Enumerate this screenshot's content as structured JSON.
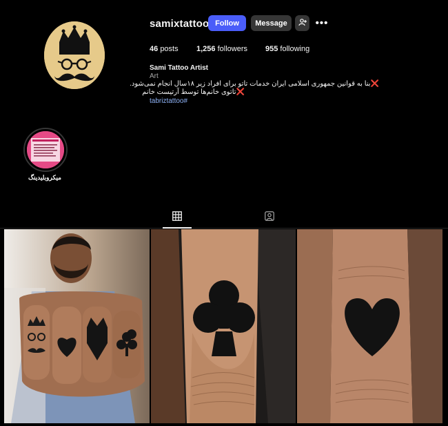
{
  "profile": {
    "username": "samixtattoo",
    "full_name": "Sami Tattoo Artist",
    "category": "Art",
    "bio_line_1": "بنا به قوانین جمهوری اسلامی ایران خدمات تاتو برای افراد زیر ۱۸سال انجام نمی‌شود.",
    "bio_line_2": "تاتوی خانم‌ها توسط آرتیست خانم",
    "bio_mark": "❌",
    "hashtag": "tabriztattoo#"
  },
  "actions": {
    "follow_label": "Follow",
    "message_label": "Message",
    "more_label": "•••",
    "suggest_icon": "person-plus-icon"
  },
  "stats": {
    "posts_count": "46",
    "posts_label": "posts",
    "followers_count": "1,256",
    "followers_label": "followers",
    "following_count": "955",
    "following_label": "following"
  },
  "highlights": [
    {
      "label": "میکروبلیدینگ"
    }
  ],
  "tabs": [
    {
      "icon": "grid-icon",
      "active": true
    },
    {
      "icon": "tagged-icon",
      "active": false
    }
  ],
  "posts": [
    {
      "subject": "knuckle tattoos: crown, heart, wolf, club"
    },
    {
      "subject": "club symbol finger tattoo"
    },
    {
      "subject": "heart symbol finger tattoo"
    }
  ],
  "colors": {
    "accent": "#4a5df9",
    "secondary_button": "#363636",
    "link": "#8fb3f7",
    "mark": "#e0245e",
    "avatar_bg": "#e6ca8a"
  }
}
